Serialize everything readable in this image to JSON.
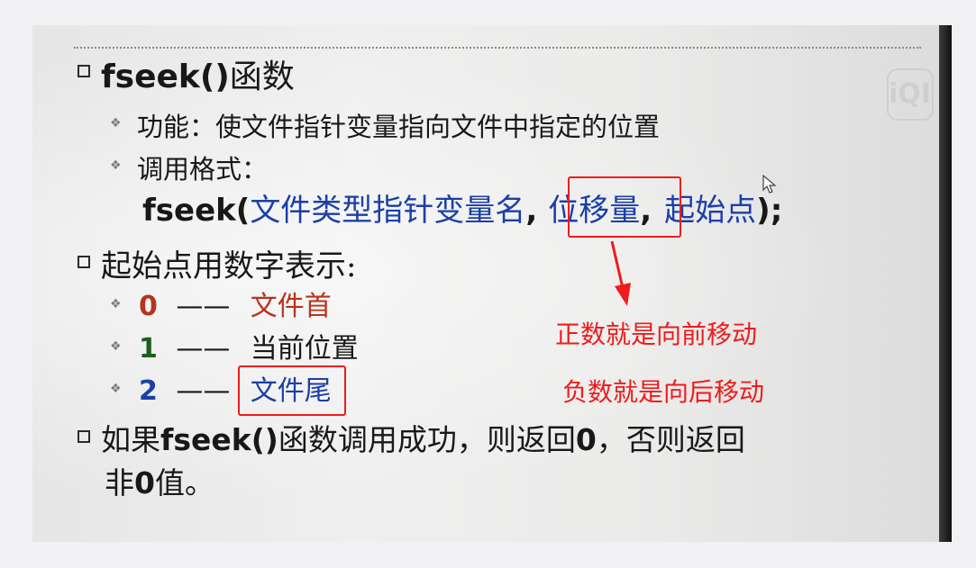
{
  "slide": {
    "heading1": {
      "code": "fseek()",
      "text": "函数"
    },
    "func_line": "功能：使文件指针变量指向文件中指定的位置",
    "call_line": "调用格式：",
    "syntax": {
      "prefix": "fseek(",
      "arg1": "文件类型指针变量名",
      "comma1": ",",
      "arg2": "位移量",
      "comma2": ",",
      "arg3": "起始点",
      "suffix": ");"
    },
    "heading2": "起始点用数字表示:",
    "options": [
      {
        "num": "0",
        "dash": "——",
        "label": "文件首"
      },
      {
        "num": "1",
        "dash": "——",
        "label": "当前位置"
      },
      {
        "num": "2",
        "dash": "——",
        "label": "文件尾"
      }
    ],
    "heading3_line1": {
      "a": "如果",
      "b": "fseek()",
      "c": "函数调用成功，则返回",
      "d": "0",
      "e": "，否则返回"
    },
    "heading3_line2": {
      "a": "非",
      "b": "0",
      "c": "值。"
    },
    "watermark": "iQIY"
  },
  "annotations": {
    "positive": "正数就是向前移动",
    "negative": "负数就是向后移动"
  },
  "colors": {
    "annotation": "#ee1c1c",
    "blue": "#1b3fa6",
    "dark_red": "#b8331b",
    "green": "#1b5e20"
  }
}
